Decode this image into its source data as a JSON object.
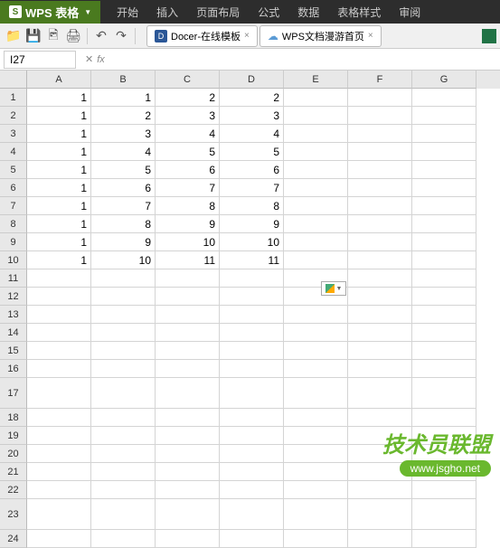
{
  "app": {
    "name": "WPS 表格"
  },
  "menu": [
    "开始",
    "插入",
    "页面布局",
    "公式",
    "数据",
    "表格样式",
    "审阅"
  ],
  "docTabs": [
    {
      "icon": "D",
      "label": "Docer-在线模板"
    },
    {
      "icon": "cloud",
      "label": "WPS文档漫游首页"
    }
  ],
  "nameBox": "I27",
  "columns": [
    "A",
    "B",
    "C",
    "D",
    "E",
    "F",
    "G"
  ],
  "rowNumbers": [
    1,
    2,
    3,
    4,
    5,
    6,
    7,
    8,
    9,
    10,
    11,
    12,
    13,
    14,
    15,
    16,
    17,
    18,
    19,
    20,
    21,
    22,
    23,
    24
  ],
  "tallRows": [
    17,
    23
  ],
  "data": {
    "1": {
      "A": "1",
      "B": "1",
      "C": "2",
      "D": "2"
    },
    "2": {
      "A": "1",
      "B": "2",
      "C": "3",
      "D": "3"
    },
    "3": {
      "A": "1",
      "B": "3",
      "C": "4",
      "D": "4"
    },
    "4": {
      "A": "1",
      "B": "4",
      "C": "5",
      "D": "5"
    },
    "5": {
      "A": "1",
      "B": "5",
      "C": "6",
      "D": "6"
    },
    "6": {
      "A": "1",
      "B": "6",
      "C": "7",
      "D": "7"
    },
    "7": {
      "A": "1",
      "B": "7",
      "C": "8",
      "D": "8"
    },
    "8": {
      "A": "1",
      "B": "8",
      "C": "9",
      "D": "9"
    },
    "9": {
      "A": "1",
      "B": "9",
      "C": "10",
      "D": "10"
    },
    "10": {
      "A": "1",
      "B": "10",
      "C": "11",
      "D": "11"
    }
  },
  "watermark": {
    "text": "技术员联盟",
    "url": "www.jsgho.net"
  }
}
